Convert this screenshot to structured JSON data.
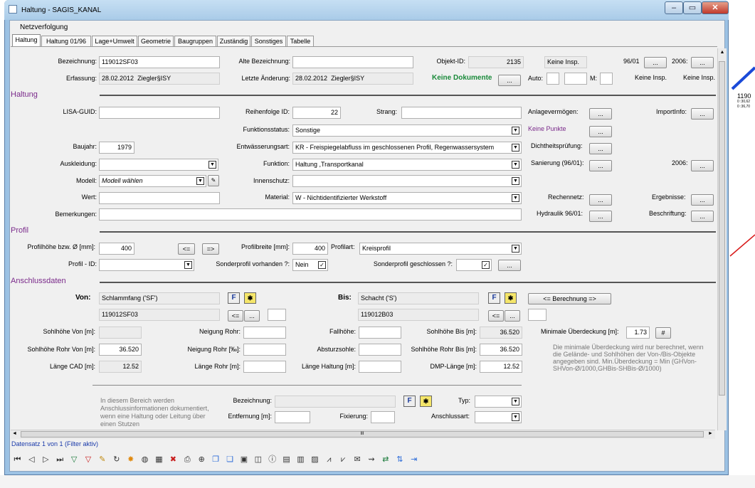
{
  "window": {
    "title": "Haltung - SAGIS_KANAL"
  },
  "menu": {
    "item": "Netzverfolgung"
  },
  "tabs": [
    "Haltung",
    "Haltung 01/96",
    "Lage+Umwelt",
    "Geometrie",
    "Baugruppen",
    "Zuständig",
    "Sonstiges",
    "Tabelle"
  ],
  "header": {
    "bezeichnung_label": "Bezeichnung:",
    "bezeichnung": "119012SF03",
    "erfassung_label": "Erfassung:",
    "erfassung_date": "28.02.2012",
    "erfassung_user": "Ziegler§ISY",
    "alte_label": "Alte Bezeichnung:",
    "alte": "",
    "letzte_label": "Letzte Änderung:",
    "letzte_date": "28.02.2012",
    "letzte_user": "Ziegler§ISY",
    "objekt_label": "Objekt-ID:",
    "objekt": "2135",
    "keine_insp": "Keine Insp.",
    "v9601": "96/01",
    "v2006": "2006:",
    "keine_dok": "Keine Dokumente",
    "auto": "Auto:",
    "m": "M:",
    "keine_insp2": "Keine Insp.",
    "keine_insp3": "Keine Insp."
  },
  "haltung": {
    "section": "Haltung",
    "lisa_label": "LISA-GUID:",
    "reihenfolge_label": "Reihenfolge ID:",
    "reihenfolge": "22",
    "strang_label": "Strang:",
    "anlage_label": "Anlagevermögen:",
    "import_label": "ImportInfo:",
    "funktionsstatus_label": "Funktionsstatus:",
    "funktionsstatus": "Sonstige",
    "keine_punkte": "Keine Punkte",
    "baujahr_label": "Baujahr:",
    "baujahr": "1979",
    "entw_label": "Entwässerungsart:",
    "entw": "KR - Freispiegelabfluss im geschlossenen Profil, Regenwassersystem",
    "dicht_label": "Dichtheitsprüfung:",
    "ausk_label": "Auskleidung:",
    "funktion_label": "Funktion:",
    "funktion": "Haltung ,Transportkanal",
    "sanierung_label": "Sanierung (96/01):",
    "san2006": "2006:",
    "modell_label": "Modell:",
    "modell": "Modell wählen",
    "innen_label": "Innenschutz:",
    "wert_label": "Wert:",
    "material_label": "Material:",
    "material": "W - Nichtidentifizierter Werkstoff",
    "rechennetz_label": "Rechennetz:",
    "ergebnisse_label": "Ergebnisse:",
    "bemerkungen_label": "Bemerkungen:",
    "hydraulik_label": "Hydraulik 96/01:",
    "beschriftung_label": "Beschriftung:"
  },
  "profil": {
    "section": "Profil",
    "hoehe_label": "Profilhöhe bzw. Ø [mm]:",
    "hoehe": "400",
    "btn_left": "<=",
    "btn_right": "=>",
    "breite_label": "Profilbreite [mm]:",
    "breite": "400",
    "art_label": "Profilart:",
    "art": "Kreisprofil",
    "id_label": "Profil - ID:",
    "sonder_label": "Sonderprofil vorhanden ?:",
    "sonder": "Nein",
    "geschl_label": "Sonderprofil geschlossen ?:",
    "check": "✓"
  },
  "anschluss": {
    "section": "Anschlussdaten",
    "von_label": "Von:",
    "von_type": "Schlammfang ('SF')",
    "von_id": "119012SF03",
    "bis_label": "Bis:",
    "bis_type": "Schacht ('S')",
    "bis_id": "119012B03",
    "f": "F",
    "berechnung": "<= Berechnung =>",
    "sohl_von_label": "Sohlhöhe Von [m]:",
    "neigung_label": "Neigung Rohr:",
    "fall_label": "Fallhöhe:",
    "sohl_bis_label": "Sohlhöhe Bis [m]:",
    "sohl_bis": "36.520",
    "min_label": "Minimale Überdeckung [m]:",
    "min": "1.73",
    "hash": "#",
    "sohlr_von_label": "Sohlhöhe Rohr Von [m]:",
    "sohlr_von": "36.520",
    "neigung_pm_label": "Neigung Rohr [‰]:",
    "absturz_label": "Absturzsohle:",
    "sohlr_bis_label": "Sohlhöhe Rohr Bis [m]:",
    "sohlr_bis": "36.520",
    "hinweis": "Die minimale Überdeckung wird nur berechnet, wenn die Gelände- und Sohlhöhen der Von-/Bis-Objekte angegeben sind. Min.Überdeckung = Min (GHVon-SHVon-Ø/1000,GHBis-SHBis-Ø/1000)",
    "laenge_cad_label": "Länge CAD [m]:",
    "laenge_cad": "12.52",
    "laenge_rohr_label": "Länge Rohr [m]:",
    "laenge_haltung_label": "Länge Haltung [m]:",
    "dmp_label": "DMP-Länge [m]:",
    "dmp": "12.52"
  },
  "stutzen": {
    "info": "In diesem Bereich werden Anschlussinformationen dokumentiert, wenn eine Haltung oder Leitung über einen Stutzen",
    "bez_label": "Bezeichnung:",
    "typ_label": "Typ:",
    "entf_label": "Entfernung [m]:",
    "fix_label": "Fixierung:",
    "art_label": "Anschlussart:"
  },
  "status": {
    "record": "Datensatz 1 von 1 (Filter aktiv)",
    "scroll_mid": "III"
  },
  "bg_text": {
    "a": "1190",
    "b": "0 :30,62",
    "c": "0 :36,70"
  },
  "colors": {
    "section": "#7a2a8a",
    "keine_dok": "#1a8a3a",
    "titlebar": "#a9cbe8"
  },
  "toolbar_icons": [
    "first-icon",
    "prev-icon",
    "next-icon",
    "last-icon",
    "filter-add-icon",
    "filter-remove-icon",
    "pencil-icon",
    "refresh-icon",
    "star-icon",
    "globe-icon",
    "grid-icon",
    "delete-icon",
    "print-icon",
    "zoom-icon",
    "copy-icon",
    "copy2-icon",
    "frame-icon",
    "layer-icon",
    "info-icon",
    "doc-icon",
    "doc2-icon",
    "image-icon",
    "chart-icon",
    "chart2-icon",
    "note-icon",
    "link-icon",
    "swap-icon",
    "export-icon",
    "exit-icon"
  ]
}
